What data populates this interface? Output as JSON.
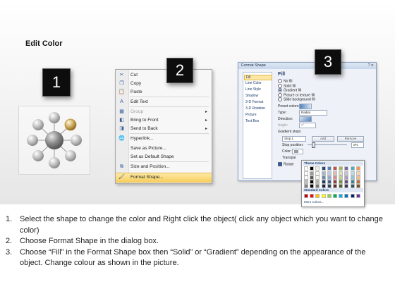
{
  "title": "Edit Color",
  "badges": [
    "1",
    "2",
    "3"
  ],
  "context_menu": {
    "items": [
      {
        "label": "Cut",
        "icon": "scissors-icon",
        "glyph": "✂",
        "disabled": false,
        "submenu": false
      },
      {
        "label": "Copy",
        "icon": "copy-icon",
        "glyph": "❐",
        "disabled": false,
        "submenu": false
      },
      {
        "label": "Paste",
        "icon": "paste-icon",
        "glyph": "📋",
        "disabled": false,
        "submenu": false
      },
      {
        "label": "Edit Text",
        "icon": "edit-text-icon",
        "glyph": "A",
        "disabled": false,
        "submenu": false
      },
      {
        "label": "Group",
        "icon": "group-icon",
        "glyph": "▦",
        "disabled": true,
        "submenu": true
      },
      {
        "label": "Bring to Front",
        "icon": "bring-to-front-icon",
        "glyph": "◧",
        "disabled": false,
        "submenu": true
      },
      {
        "label": "Send to Back",
        "icon": "send-to-back-icon",
        "glyph": "◨",
        "disabled": false,
        "submenu": true
      },
      {
        "label": "Hyperlink...",
        "icon": "hyperlink-icon",
        "glyph": "🌐",
        "disabled": false,
        "submenu": false
      },
      {
        "label": "Save as Picture...",
        "icon": "",
        "glyph": "",
        "disabled": false,
        "submenu": false
      },
      {
        "label": "Set as Default Shape",
        "icon": "",
        "glyph": "",
        "disabled": false,
        "submenu": false
      },
      {
        "label": "Size and Position...",
        "icon": "size-position-icon",
        "glyph": "⧉",
        "disabled": false,
        "submenu": false
      },
      {
        "label": "Format Shape...",
        "icon": "format-shape-icon",
        "glyph": "🖌",
        "disabled": false,
        "submenu": false,
        "highlighted": true
      }
    ]
  },
  "dialog": {
    "title": "Format Shape",
    "window_buttons": "? ✕",
    "nav": [
      "Fill",
      "Line Color",
      "Line Style",
      "Shadow",
      "3-D Format",
      "3-D Rotation",
      "Picture",
      "Text Box"
    ],
    "nav_selected": "Fill",
    "heading": "Fill",
    "fill_options": [
      "No fill",
      "Solid fill",
      "Gradient fill",
      "Picture or texture fill",
      "Slide background fill"
    ],
    "fill_selected": "Gradient fill",
    "preset_colors_label": "Preset colors:",
    "type_label": "Type:",
    "type_value": "Radial",
    "direction_label": "Direction:",
    "angle_label": "Angle:",
    "angle_value": "0°",
    "gradient_stops_label": "Gradient stops",
    "stop_value": "Stop 1",
    "add_label": "Add",
    "remove_label": "Remove",
    "stop_position_label": "Stop position:",
    "stop_position_value": "0%",
    "color_label": "Color:",
    "transparency_label": "Transpar",
    "rotate_label": "Rotate"
  },
  "picker": {
    "theme_label": "Theme Colors",
    "standard_label": "Standard Colors",
    "more_label": "More Colors...",
    "theme_top": [
      "#ffffff",
      "#000000",
      "#eeece1",
      "#1f497d",
      "#4f81bd",
      "#c0504d",
      "#9bbb59",
      "#8064a2",
      "#4bacc6",
      "#f79646"
    ],
    "standard": [
      "#c00000",
      "#ff0000",
      "#ffc000",
      "#ffff00",
      "#92d050",
      "#00b050",
      "#00b0f0",
      "#0070c0",
      "#002060",
      "#7030a0"
    ]
  },
  "instructions": [
    {
      "num": "1.",
      "text": "Select the shape to change the color and Right click the object( click any object which you want to change color)"
    },
    {
      "num": "2.",
      "text": "Choose Format Shape in the dialog box."
    },
    {
      "num": "3.",
      "text": "Choose “Fill” in the Format Shape box then “Solid” or “Gradient” depending on the appearance of the object. Change colour as shown in the picture."
    }
  ]
}
